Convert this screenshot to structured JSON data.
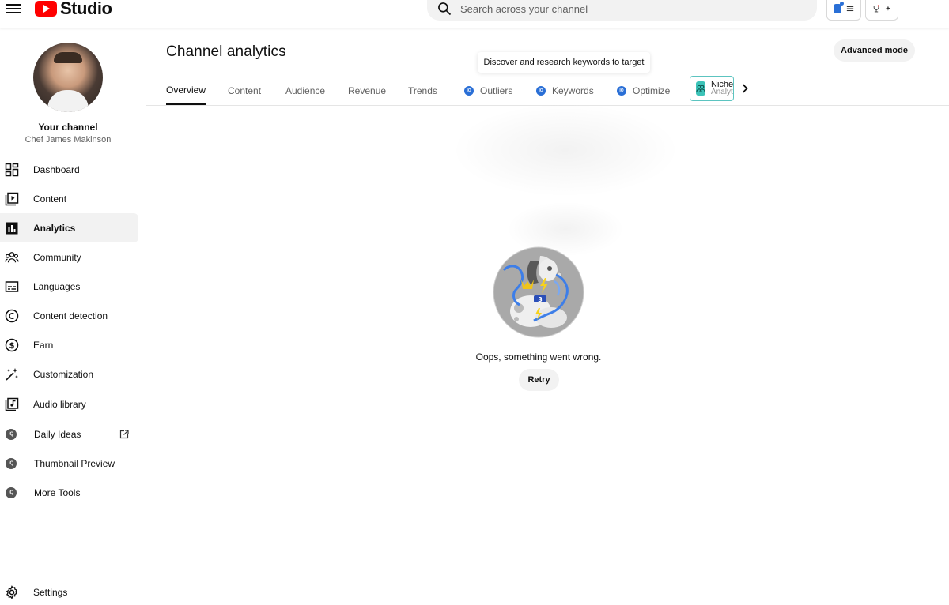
{
  "app": {
    "logo_text": "Studio"
  },
  "search": {
    "placeholder": "Search across your channel"
  },
  "sidebar": {
    "channel_title": "Your channel",
    "channel_name": "Chef James Makinson",
    "items": [
      {
        "label": "Dashboard",
        "icon": "dashboard-icon"
      },
      {
        "label": "Content",
        "icon": "content-icon"
      },
      {
        "label": "Analytics",
        "icon": "analytics-icon",
        "active": true
      },
      {
        "label": "Community",
        "icon": "community-icon"
      },
      {
        "label": "Languages",
        "icon": "subtitles-icon"
      },
      {
        "label": "Content detection",
        "icon": "copyright-icon"
      },
      {
        "label": "Earn",
        "icon": "dollar-icon"
      },
      {
        "label": "Customization",
        "icon": "magic-wand-icon"
      },
      {
        "label": "Audio library",
        "icon": "audio-library-icon"
      },
      {
        "label": "Daily Ideas",
        "icon": "vidiq-icon",
        "external": true
      },
      {
        "label": "Thumbnail Preview",
        "icon": "vidiq-icon"
      },
      {
        "label": "More Tools",
        "icon": "vidiq-icon"
      }
    ],
    "settings_label": "Settings"
  },
  "main": {
    "title": "Channel analytics",
    "advanced_mode_label": "Advanced mode",
    "tooltip": "Discover and research keywords to target",
    "tabs": [
      {
        "label": "Overview",
        "active": true
      },
      {
        "label": "Content"
      },
      {
        "label": "Audience"
      },
      {
        "label": "Revenue"
      },
      {
        "label": "Trends"
      },
      {
        "label": "Outliers",
        "badge": "iq"
      },
      {
        "label": "Keywords",
        "badge": "iq"
      },
      {
        "label": "Optimize",
        "badge": "iq"
      }
    ],
    "niche_tab": {
      "line1": "Niche",
      "line2": "Analytics"
    },
    "error": {
      "message": "Oops, something went wrong.",
      "retry_label": "Retry"
    }
  },
  "colors": {
    "brand_red": "#ff0000",
    "vidiq_blue": "#2a6fd6",
    "niche_teal": "#3cc3b8"
  }
}
